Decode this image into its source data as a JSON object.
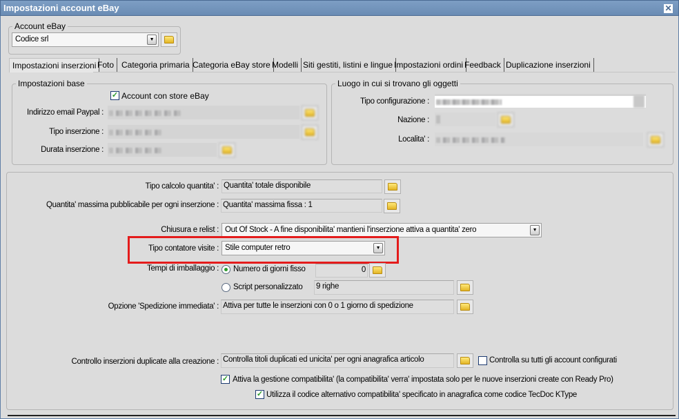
{
  "window": {
    "title": "Impostazioni account eBay"
  },
  "account": {
    "group_label": "Account eBay",
    "selected": "Codice srl"
  },
  "tabs": [
    {
      "label": "Impostazioni inserzioni",
      "active": true
    },
    {
      "label": "Foto"
    },
    {
      "label": "Categoria primaria"
    },
    {
      "label": "Categoria eBay store"
    },
    {
      "label": "Modelli"
    },
    {
      "label": "Siti gestiti, listini e lingue"
    },
    {
      "label": "Impostazioni ordini"
    },
    {
      "label": "Feedback"
    },
    {
      "label": "Duplicazione inserzioni"
    }
  ],
  "base": {
    "group_label": "Impostazioni base",
    "store_checkbox": "Account con store eBay",
    "store_checked": true,
    "email_label": "Indirizzo email Paypal :",
    "tipo_label": "Tipo inserzione :",
    "durata_label": "Durata inserzione :"
  },
  "luogo": {
    "group_label": "Luogo in cui si trovano gli oggetti",
    "config_label": "Tipo configurazione :",
    "nazione_label": "Nazione :",
    "localita_label": "Localita' :"
  },
  "main": {
    "calcolo_label": "Tipo calcolo quantita' :",
    "calcolo_value": "Quantita' totale disponibile",
    "massima_label": "Quantita' massima pubblicabile per ogni inserzione :",
    "massima_value": "Quantita' massima fissa : 1",
    "chiusura_label": "Chiusura e relist :",
    "chiusura_value": "Out Of Stock - A fine disponibilita' mantieni l'inserzione attiva a quantita' zero",
    "contatore_label": "Tipo contatore visite :",
    "contatore_value": "Stile computer retro",
    "tempi_label": "Tempi di imballaggio :",
    "radio_fisso": "Numero di giorni fisso",
    "fisso_value": "0",
    "radio_script": "Script personalizzato",
    "script_value": "9 righe",
    "spedizione_label": "Opzione 'Spedizione immediata' :",
    "spedizione_value": "Attiva per tutte le inserzioni con 0 o 1 giorno di spedizione",
    "duplicate_label": "Controllo inserzioni duplicate alla creazione :",
    "duplicate_value": "Controlla titoli duplicati ed unicita' per ogni anagrafica articolo",
    "all_accounts": "Controlla su tutti gli account configurati",
    "compat": "Attiva la gestione compatibilita'  (la compatibilita' verra' impostata solo per le nuove inserzioni create con Ready Pro)",
    "tecdoc": "Utilizza il codice alternativo compatibilita' specificato in anagrafica come codice TecDoc KType"
  },
  "colors": {
    "highlight": "#e41b1b",
    "titlebar": "#6f8fb7"
  }
}
